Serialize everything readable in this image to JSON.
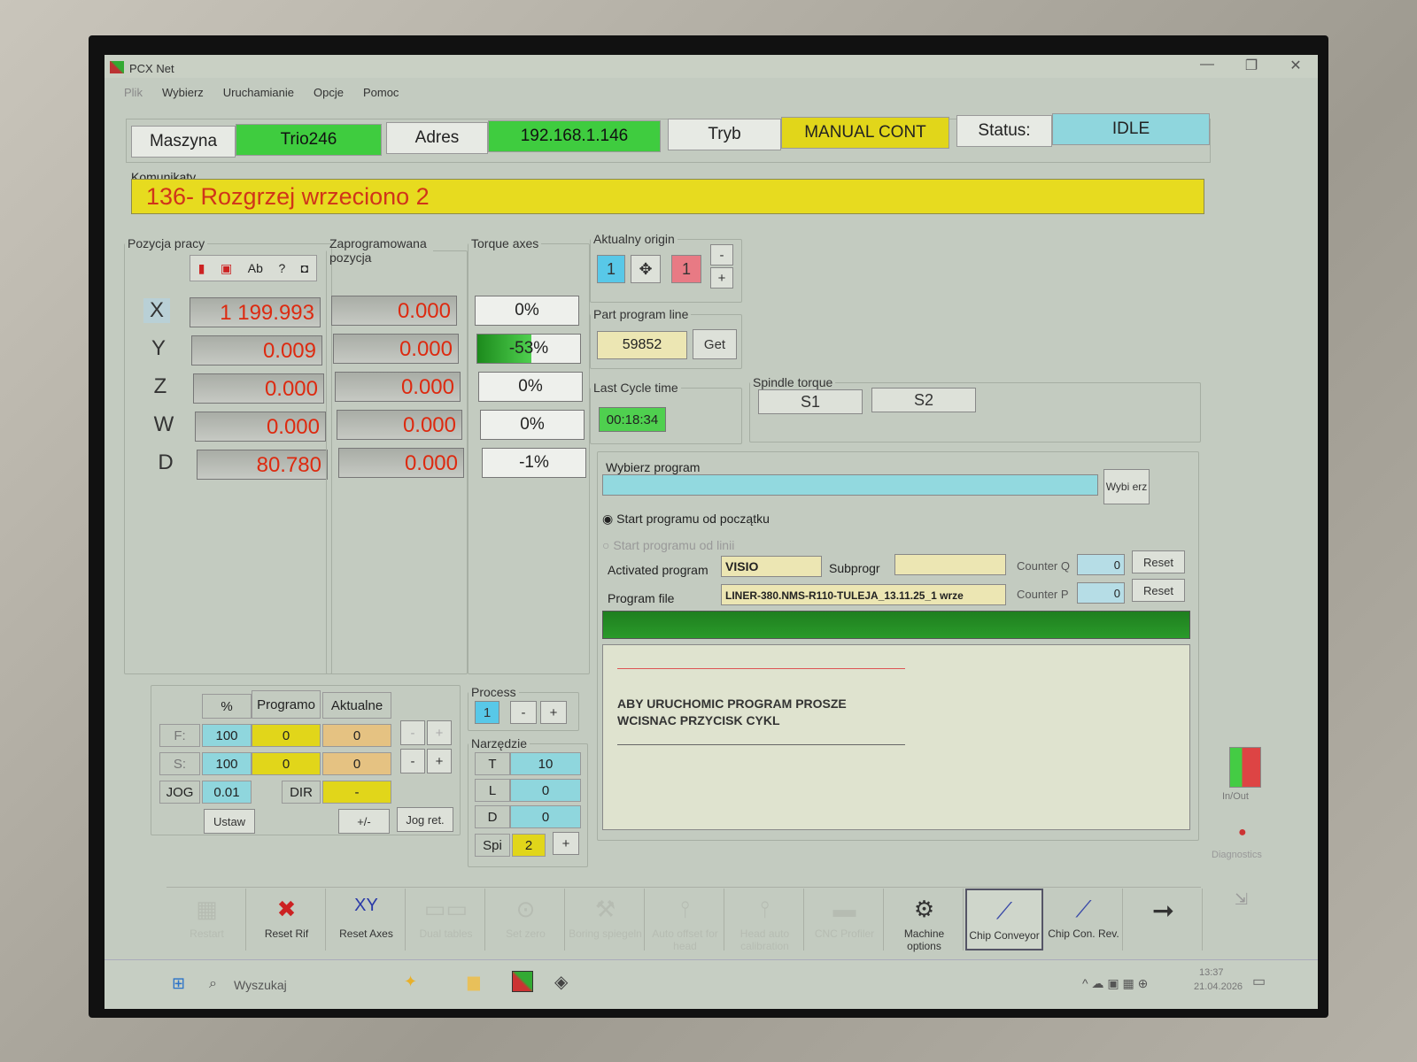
{
  "window": {
    "title": "PCX Net",
    "minimize": "—",
    "restore": "❐",
    "close": "✕"
  },
  "menu": [
    "Plik",
    "Wybierz",
    "Uruchamianie",
    "Opcje",
    "Pomoc"
  ],
  "header": {
    "machine_label": "Maszyna",
    "machine_value": "Trio246",
    "address_label": "Adres",
    "address_value": "192.168.1.146",
    "mode_label": "Tryb",
    "mode_value": "MANUAL CONT",
    "status_label": "Status:",
    "status_value": "IDLE"
  },
  "messages": {
    "label": "Komunikaty",
    "text": "136- Rozgrzej wrzeciono 2"
  },
  "work_position": {
    "label": "Pozycja pracy",
    "axes": [
      "X",
      "Y",
      "Z",
      "W",
      "D"
    ],
    "values": [
      "1 199.993",
      "0.009",
      "0.000",
      "0.000",
      "80.780"
    ],
    "toolbar_text": "Ab"
  },
  "programmed_position": {
    "label": "Zaprogramowana pozycja",
    "values": [
      "0.000",
      "0.000",
      "0.000",
      "0.000",
      "0.000"
    ]
  },
  "torque_axes": {
    "label": "Torque axes",
    "values": [
      "0%",
      "-53%",
      "0%",
      "0%",
      "-1%"
    ],
    "bar_level": 0.53
  },
  "origin": {
    "label": "Aktualny origin",
    "left": "1",
    "right": "1",
    "minus": "-",
    "plus": "+"
  },
  "part_program_line": {
    "label": "Part program line",
    "value": "59852",
    "get": "Get"
  },
  "last_cycle": {
    "label": "Last Cycle time",
    "value": "00:18:34"
  },
  "spindle_torque": {
    "label": "Spindle torque",
    "s1": "S1",
    "s2": "S2"
  },
  "program_select": {
    "label": "Wybierz program",
    "button": "Wybi erz",
    "radio1": "Start programu od początku",
    "radio2": "Start programu od linii",
    "activated_label": "Activated program",
    "activated_value": "VISIO",
    "subprog_label": "Subprogr",
    "subprog_value": "",
    "file_label": "Program file",
    "file_value": "LINER-380.NMS-R110-TULEJA_13.11.25_1 wrze",
    "counter_q_label": "Counter Q",
    "counter_q_value": "0",
    "counter_p_label": "Counter P",
    "counter_p_value": "0",
    "reset": "Reset"
  },
  "console": {
    "line1": "ABY URUCHOMIC PROGRAM PROSZE",
    "line2": "WCISNAC PRZYCISK CYKL"
  },
  "feed": {
    "h_pct": "%",
    "h_prog": "Programo",
    "h_act": "Aktualne",
    "f_label": "F:",
    "f_pct": "100",
    "f_prog": "0",
    "f_act": "0",
    "s_label": "S:",
    "s_pct": "100",
    "s_prog": "0",
    "s_act": "0",
    "jog_label": "JOG",
    "jog_value": "0.01",
    "dir_label": "DIR",
    "dir_value": "-",
    "ustaw": "Ustaw",
    "plusminus": "+/-",
    "jogret": "Jog ret.",
    "minus": "-",
    "plus": "+"
  },
  "process": {
    "label": "Process",
    "value": "1",
    "minus": "-",
    "plus": "+"
  },
  "tool": {
    "label": "Narzędzie",
    "t_label": "T",
    "t_value": "10",
    "l_label": "L",
    "l_value": "0",
    "d_label": "D",
    "d_value": "0",
    "spi_label": "Spi",
    "spi_value": "2",
    "plus": "+"
  },
  "toolbar": [
    "Restart",
    "Reset Rif",
    "Reset Axes",
    "Dual tables",
    "Set zero",
    "Boring spiegeln",
    "Auto offset for head",
    "Head auto calibration",
    "CNC Profiler",
    "Machine options",
    "Chip Conveyor",
    "Chip Con. Rev."
  ],
  "side": {
    "inout": "In/Out",
    "diag": "Diagnostics"
  },
  "taskbar": {
    "search": "Wyszukaj",
    "time": "13:37",
    "date": "21.04.2026"
  }
}
